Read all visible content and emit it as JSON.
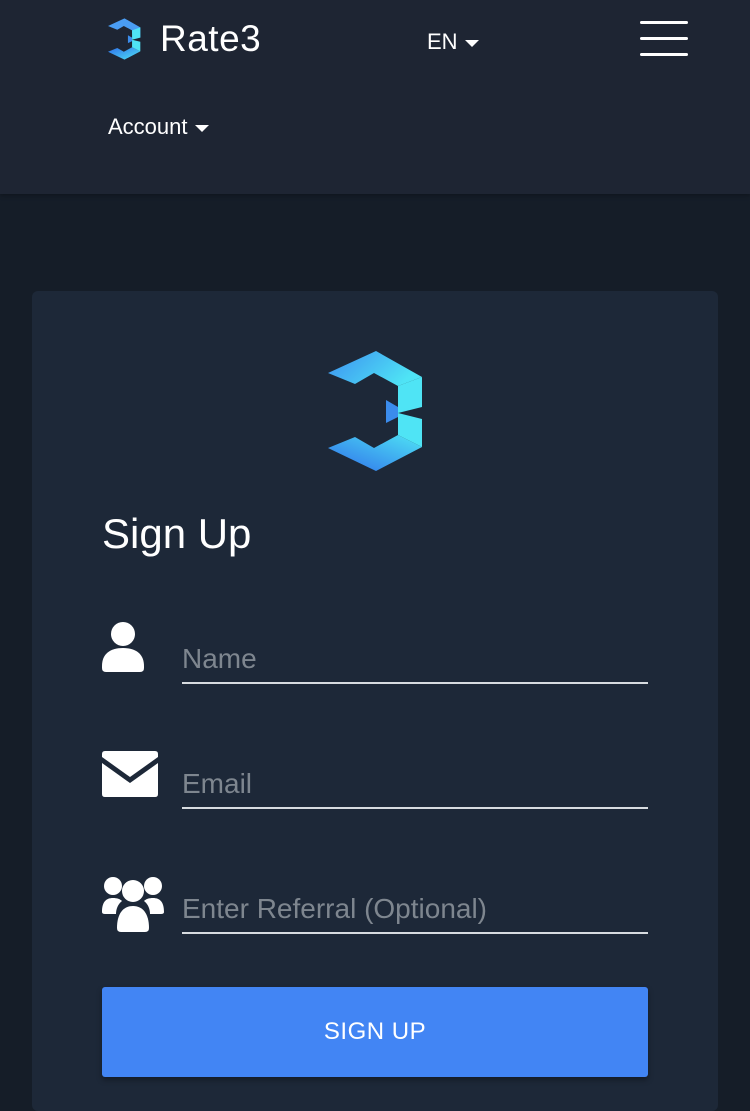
{
  "header": {
    "brand_name": "Rate3",
    "language": "EN",
    "account_label": "Account"
  },
  "signup": {
    "title": "Sign Up",
    "name_placeholder": "Name",
    "email_placeholder": "Email",
    "referral_placeholder": "Enter Referral (Optional)",
    "button_label": "SIGN UP"
  },
  "icons": {
    "brand": "rate3-logo-icon",
    "language_caret": "caret-down-icon",
    "menu": "hamburger-menu-icon",
    "name": "user-icon",
    "email": "envelope-icon",
    "referral": "users-group-icon"
  },
  "colors": {
    "page_background": "#151d28",
    "header_background": "#1e2533",
    "card_background": "#1d2838",
    "logo_cyan": "#4fe4f5",
    "logo_blue": "#4a8cf0",
    "button_blue": "#4285f4",
    "placeholder_gray": "#7e868f",
    "underline": "#d7dbe0"
  }
}
